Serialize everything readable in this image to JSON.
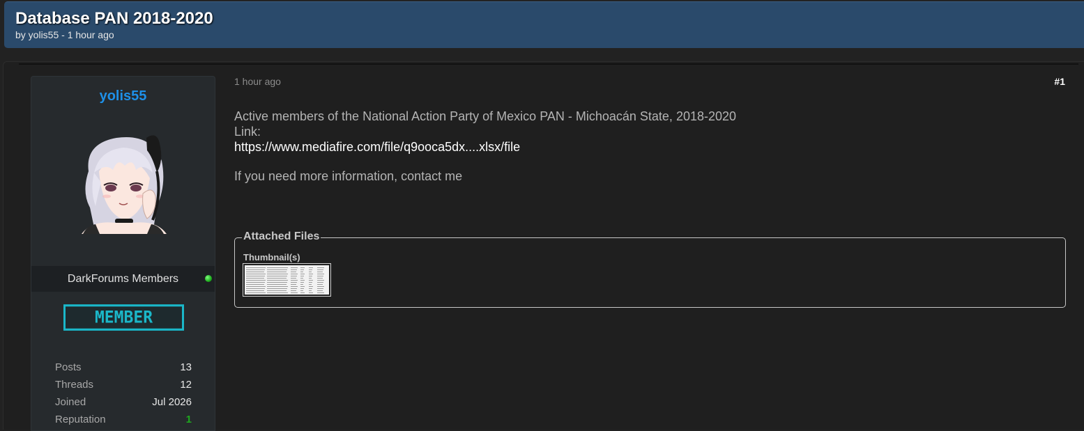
{
  "thread": {
    "title": "Database PAN 2018-2020",
    "meta": "by yolis55 - 1 hour ago"
  },
  "author": {
    "username": "yolis55",
    "usergroup": "DarkForums Members",
    "online": true,
    "badge": "MEMBER",
    "stats": [
      {
        "label": "Posts",
        "value": "13"
      },
      {
        "label": "Threads",
        "value": "12"
      },
      {
        "label": "Joined",
        "value": "Jul 2026"
      },
      {
        "label": "Reputation",
        "value": "1"
      }
    ]
  },
  "post": {
    "time": "1 hour ago",
    "number": "#1",
    "lines": [
      "Active members of the National Action Party of Mexico  PAN - Michoacán State, 2018-2020",
      "Link:"
    ],
    "link": "https://www.mediafire.com/file/q9ooca5dx....xlsx/file",
    "closing": "If you need more information, contact me"
  },
  "attachments": {
    "legend": "Attached Files",
    "thumbnails_label": "Thumbnail(s)"
  },
  "colors": {
    "header_bg": "#2a4a6b",
    "username": "#1e90e8",
    "badge": "#1bb7c9",
    "reputation": "#1ea81e",
    "online": "#1fae1f"
  }
}
